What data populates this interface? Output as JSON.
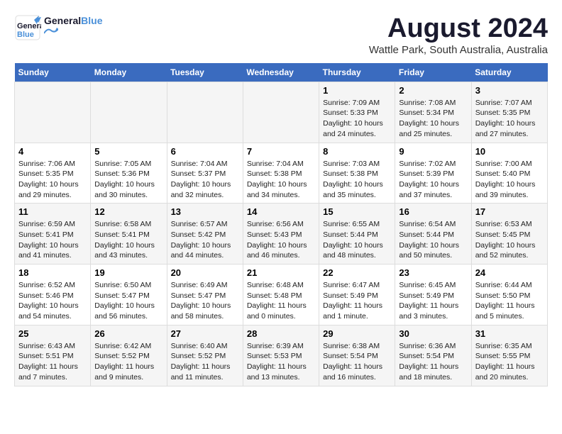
{
  "header": {
    "logo_general": "General",
    "logo_blue": "Blue",
    "month": "August 2024",
    "location": "Wattle Park, South Australia, Australia"
  },
  "columns": [
    "Sunday",
    "Monday",
    "Tuesday",
    "Wednesday",
    "Thursday",
    "Friday",
    "Saturday"
  ],
  "weeks": [
    [
      {
        "day": "",
        "info": ""
      },
      {
        "day": "",
        "info": ""
      },
      {
        "day": "",
        "info": ""
      },
      {
        "day": "",
        "info": ""
      },
      {
        "day": "1",
        "info": "Sunrise: 7:09 AM\nSunset: 5:33 PM\nDaylight: 10 hours\nand 24 minutes."
      },
      {
        "day": "2",
        "info": "Sunrise: 7:08 AM\nSunset: 5:34 PM\nDaylight: 10 hours\nand 25 minutes."
      },
      {
        "day": "3",
        "info": "Sunrise: 7:07 AM\nSunset: 5:35 PM\nDaylight: 10 hours\nand 27 minutes."
      }
    ],
    [
      {
        "day": "4",
        "info": "Sunrise: 7:06 AM\nSunset: 5:35 PM\nDaylight: 10 hours\nand 29 minutes."
      },
      {
        "day": "5",
        "info": "Sunrise: 7:05 AM\nSunset: 5:36 PM\nDaylight: 10 hours\nand 30 minutes."
      },
      {
        "day": "6",
        "info": "Sunrise: 7:04 AM\nSunset: 5:37 PM\nDaylight: 10 hours\nand 32 minutes."
      },
      {
        "day": "7",
        "info": "Sunrise: 7:04 AM\nSunset: 5:38 PM\nDaylight: 10 hours\nand 34 minutes."
      },
      {
        "day": "8",
        "info": "Sunrise: 7:03 AM\nSunset: 5:38 PM\nDaylight: 10 hours\nand 35 minutes."
      },
      {
        "day": "9",
        "info": "Sunrise: 7:02 AM\nSunset: 5:39 PM\nDaylight: 10 hours\nand 37 minutes."
      },
      {
        "day": "10",
        "info": "Sunrise: 7:00 AM\nSunset: 5:40 PM\nDaylight: 10 hours\nand 39 minutes."
      }
    ],
    [
      {
        "day": "11",
        "info": "Sunrise: 6:59 AM\nSunset: 5:41 PM\nDaylight: 10 hours\nand 41 minutes."
      },
      {
        "day": "12",
        "info": "Sunrise: 6:58 AM\nSunset: 5:41 PM\nDaylight: 10 hours\nand 43 minutes."
      },
      {
        "day": "13",
        "info": "Sunrise: 6:57 AM\nSunset: 5:42 PM\nDaylight: 10 hours\nand 44 minutes."
      },
      {
        "day": "14",
        "info": "Sunrise: 6:56 AM\nSunset: 5:43 PM\nDaylight: 10 hours\nand 46 minutes."
      },
      {
        "day": "15",
        "info": "Sunrise: 6:55 AM\nSunset: 5:44 PM\nDaylight: 10 hours\nand 48 minutes."
      },
      {
        "day": "16",
        "info": "Sunrise: 6:54 AM\nSunset: 5:44 PM\nDaylight: 10 hours\nand 50 minutes."
      },
      {
        "day": "17",
        "info": "Sunrise: 6:53 AM\nSunset: 5:45 PM\nDaylight: 10 hours\nand 52 minutes."
      }
    ],
    [
      {
        "day": "18",
        "info": "Sunrise: 6:52 AM\nSunset: 5:46 PM\nDaylight: 10 hours\nand 54 minutes."
      },
      {
        "day": "19",
        "info": "Sunrise: 6:50 AM\nSunset: 5:47 PM\nDaylight: 10 hours\nand 56 minutes."
      },
      {
        "day": "20",
        "info": "Sunrise: 6:49 AM\nSunset: 5:47 PM\nDaylight: 10 hours\nand 58 minutes."
      },
      {
        "day": "21",
        "info": "Sunrise: 6:48 AM\nSunset: 5:48 PM\nDaylight: 11 hours\nand 0 minutes."
      },
      {
        "day": "22",
        "info": "Sunrise: 6:47 AM\nSunset: 5:49 PM\nDaylight: 11 hours\nand 1 minute."
      },
      {
        "day": "23",
        "info": "Sunrise: 6:45 AM\nSunset: 5:49 PM\nDaylight: 11 hours\nand 3 minutes."
      },
      {
        "day": "24",
        "info": "Sunrise: 6:44 AM\nSunset: 5:50 PM\nDaylight: 11 hours\nand 5 minutes."
      }
    ],
    [
      {
        "day": "25",
        "info": "Sunrise: 6:43 AM\nSunset: 5:51 PM\nDaylight: 11 hours\nand 7 minutes."
      },
      {
        "day": "26",
        "info": "Sunrise: 6:42 AM\nSunset: 5:52 PM\nDaylight: 11 hours\nand 9 minutes."
      },
      {
        "day": "27",
        "info": "Sunrise: 6:40 AM\nSunset: 5:52 PM\nDaylight: 11 hours\nand 11 minutes."
      },
      {
        "day": "28",
        "info": "Sunrise: 6:39 AM\nSunset: 5:53 PM\nDaylight: 11 hours\nand 13 minutes."
      },
      {
        "day": "29",
        "info": "Sunrise: 6:38 AM\nSunset: 5:54 PM\nDaylight: 11 hours\nand 16 minutes."
      },
      {
        "day": "30",
        "info": "Sunrise: 6:36 AM\nSunset: 5:54 PM\nDaylight: 11 hours\nand 18 minutes."
      },
      {
        "day": "31",
        "info": "Sunrise: 6:35 AM\nSunset: 5:55 PM\nDaylight: 11 hours\nand 20 minutes."
      }
    ]
  ]
}
